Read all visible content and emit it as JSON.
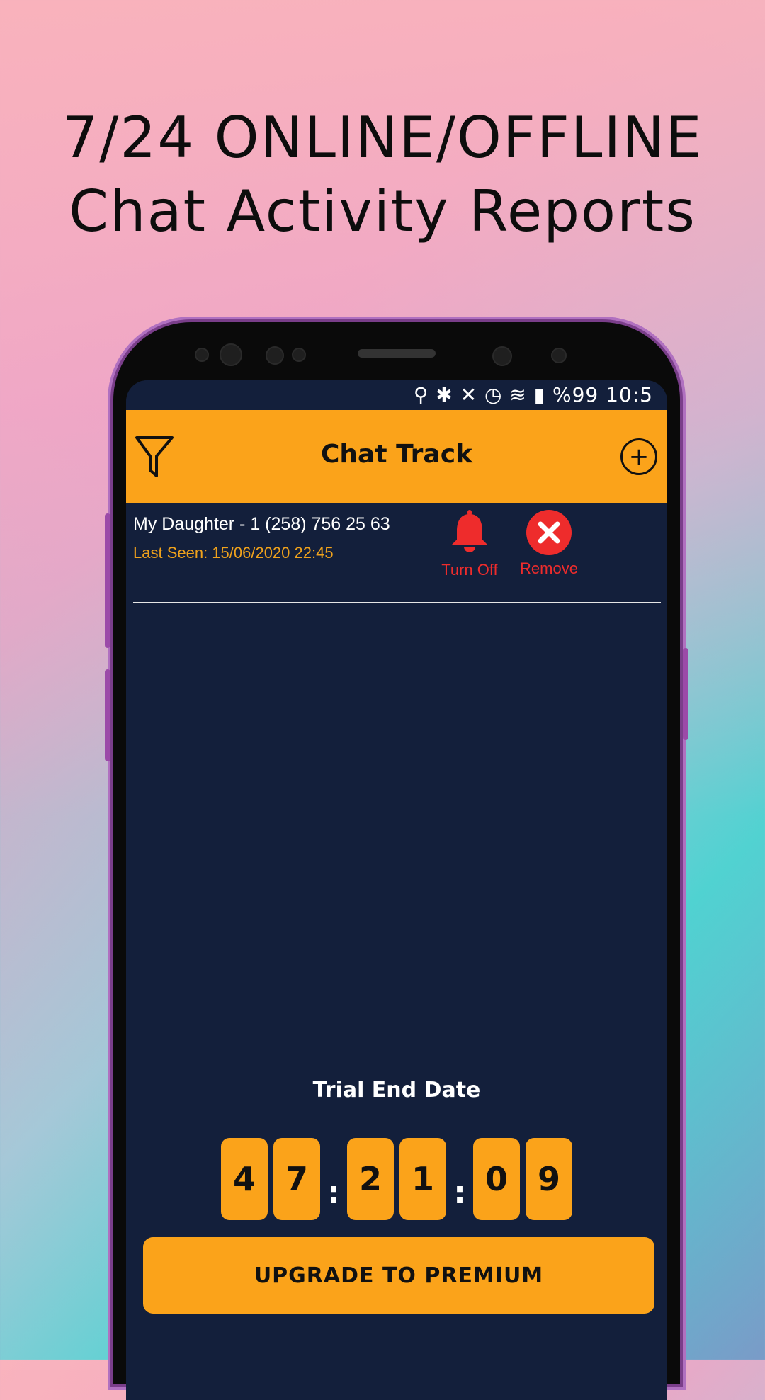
{
  "promo": {
    "line1": "7/24 ONLINE/OFFLINE",
    "line2": "Chat Activity Reports"
  },
  "statusbar": {
    "text": "%99 10:5"
  },
  "appbar": {
    "title": "Chat Track",
    "left_icon": "filter-icon",
    "right_icon": "add-circle-icon",
    "add_symbol": "+"
  },
  "contacts": [
    {
      "name": "My Daughter - 1 (258) 756 25 63",
      "last_seen": "Last Seen: 15/06/2020 22:45",
      "turn_off_label": "Turn Off",
      "remove_label": "Remove"
    }
  ],
  "trial": {
    "title": "Trial End Date",
    "digits": [
      "4",
      "7",
      "2",
      "1",
      "0",
      "9"
    ],
    "separator": ":"
  },
  "upgrade_label": "UPGRADE TO PREMIUM",
  "colors": {
    "accent": "#fba31a",
    "screen_bg": "#131f3b",
    "danger": "#ee2c2c",
    "last_seen": "#f0a21c"
  }
}
